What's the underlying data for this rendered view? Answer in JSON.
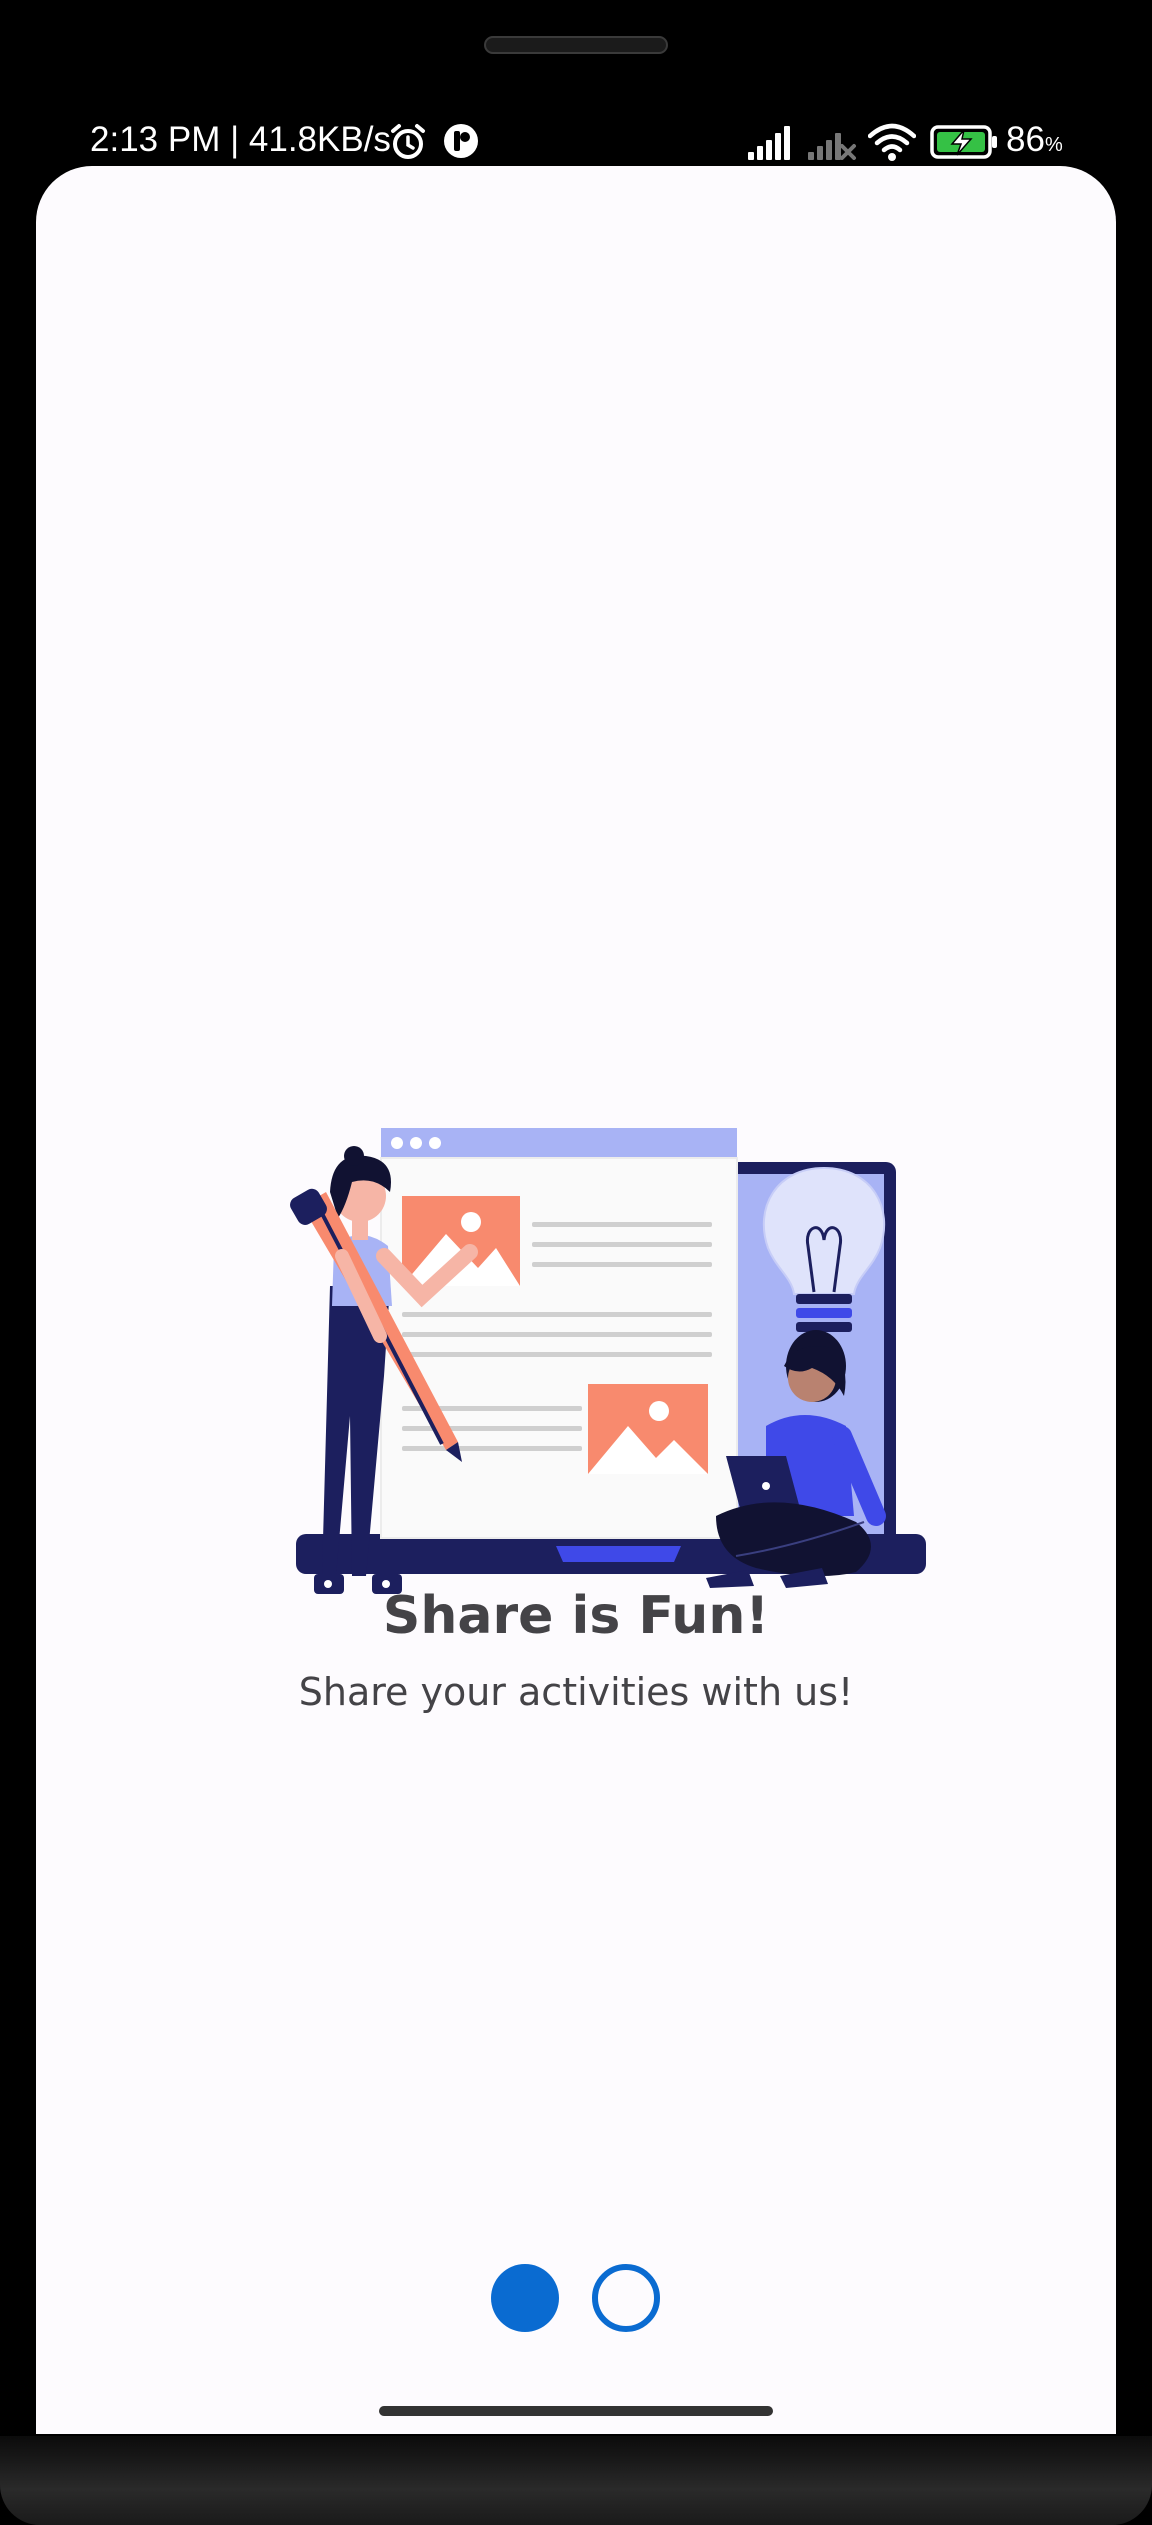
{
  "status_bar": {
    "time_speed": "2:13 PM | 41.8KB/s",
    "battery_percent": "86",
    "battery_unit": "%",
    "icons": [
      "alarm-icon",
      "app-notification-icon",
      "signal-icon",
      "signal-no-service-icon",
      "wifi-icon",
      "battery-charging-icon"
    ]
  },
  "onboarding": {
    "title": "Share is Fun!",
    "subtitle": "Share your activities with us!",
    "page_indicator": {
      "total": 2,
      "current": 1
    }
  },
  "colors": {
    "accent": "#0a6bd1",
    "text": "#444347",
    "background": "#fdfbfe",
    "illustration_navy": "#1c1f5e",
    "illustration_coral": "#f88a6e",
    "illustration_lavender": "#a8b3f5"
  }
}
